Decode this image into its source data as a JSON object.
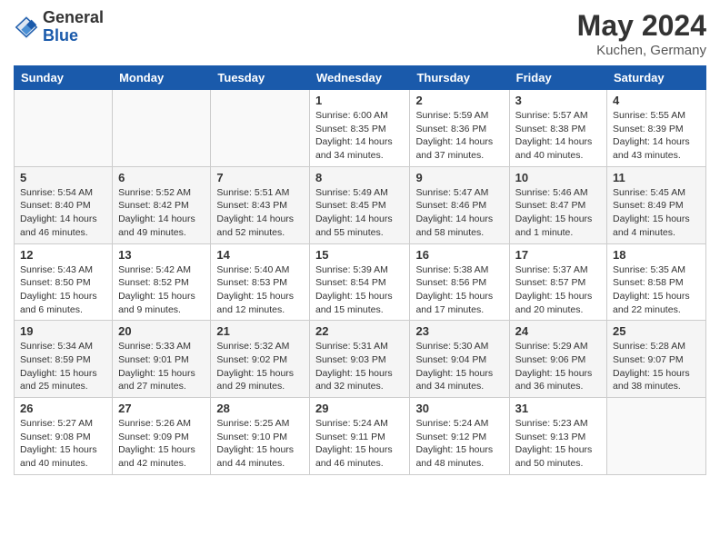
{
  "header": {
    "logo_general": "General",
    "logo_blue": "Blue",
    "month_year": "May 2024",
    "location": "Kuchen, Germany"
  },
  "weekdays": [
    "Sunday",
    "Monday",
    "Tuesday",
    "Wednesday",
    "Thursday",
    "Friday",
    "Saturday"
  ],
  "weeks": [
    [
      {
        "day": "",
        "info": ""
      },
      {
        "day": "",
        "info": ""
      },
      {
        "day": "",
        "info": ""
      },
      {
        "day": "1",
        "info": "Sunrise: 6:00 AM\nSunset: 8:35 PM\nDaylight: 14 hours\nand 34 minutes."
      },
      {
        "day": "2",
        "info": "Sunrise: 5:59 AM\nSunset: 8:36 PM\nDaylight: 14 hours\nand 37 minutes."
      },
      {
        "day": "3",
        "info": "Sunrise: 5:57 AM\nSunset: 8:38 PM\nDaylight: 14 hours\nand 40 minutes."
      },
      {
        "day": "4",
        "info": "Sunrise: 5:55 AM\nSunset: 8:39 PM\nDaylight: 14 hours\nand 43 minutes."
      }
    ],
    [
      {
        "day": "5",
        "info": "Sunrise: 5:54 AM\nSunset: 8:40 PM\nDaylight: 14 hours\nand 46 minutes."
      },
      {
        "day": "6",
        "info": "Sunrise: 5:52 AM\nSunset: 8:42 PM\nDaylight: 14 hours\nand 49 minutes."
      },
      {
        "day": "7",
        "info": "Sunrise: 5:51 AM\nSunset: 8:43 PM\nDaylight: 14 hours\nand 52 minutes."
      },
      {
        "day": "8",
        "info": "Sunrise: 5:49 AM\nSunset: 8:45 PM\nDaylight: 14 hours\nand 55 minutes."
      },
      {
        "day": "9",
        "info": "Sunrise: 5:47 AM\nSunset: 8:46 PM\nDaylight: 14 hours\nand 58 minutes."
      },
      {
        "day": "10",
        "info": "Sunrise: 5:46 AM\nSunset: 8:47 PM\nDaylight: 15 hours\nand 1 minute."
      },
      {
        "day": "11",
        "info": "Sunrise: 5:45 AM\nSunset: 8:49 PM\nDaylight: 15 hours\nand 4 minutes."
      }
    ],
    [
      {
        "day": "12",
        "info": "Sunrise: 5:43 AM\nSunset: 8:50 PM\nDaylight: 15 hours\nand 6 minutes."
      },
      {
        "day": "13",
        "info": "Sunrise: 5:42 AM\nSunset: 8:52 PM\nDaylight: 15 hours\nand 9 minutes."
      },
      {
        "day": "14",
        "info": "Sunrise: 5:40 AM\nSunset: 8:53 PM\nDaylight: 15 hours\nand 12 minutes."
      },
      {
        "day": "15",
        "info": "Sunrise: 5:39 AM\nSunset: 8:54 PM\nDaylight: 15 hours\nand 15 minutes."
      },
      {
        "day": "16",
        "info": "Sunrise: 5:38 AM\nSunset: 8:56 PM\nDaylight: 15 hours\nand 17 minutes."
      },
      {
        "day": "17",
        "info": "Sunrise: 5:37 AM\nSunset: 8:57 PM\nDaylight: 15 hours\nand 20 minutes."
      },
      {
        "day": "18",
        "info": "Sunrise: 5:35 AM\nSunset: 8:58 PM\nDaylight: 15 hours\nand 22 minutes."
      }
    ],
    [
      {
        "day": "19",
        "info": "Sunrise: 5:34 AM\nSunset: 8:59 PM\nDaylight: 15 hours\nand 25 minutes."
      },
      {
        "day": "20",
        "info": "Sunrise: 5:33 AM\nSunset: 9:01 PM\nDaylight: 15 hours\nand 27 minutes."
      },
      {
        "day": "21",
        "info": "Sunrise: 5:32 AM\nSunset: 9:02 PM\nDaylight: 15 hours\nand 29 minutes."
      },
      {
        "day": "22",
        "info": "Sunrise: 5:31 AM\nSunset: 9:03 PM\nDaylight: 15 hours\nand 32 minutes."
      },
      {
        "day": "23",
        "info": "Sunrise: 5:30 AM\nSunset: 9:04 PM\nDaylight: 15 hours\nand 34 minutes."
      },
      {
        "day": "24",
        "info": "Sunrise: 5:29 AM\nSunset: 9:06 PM\nDaylight: 15 hours\nand 36 minutes."
      },
      {
        "day": "25",
        "info": "Sunrise: 5:28 AM\nSunset: 9:07 PM\nDaylight: 15 hours\nand 38 minutes."
      }
    ],
    [
      {
        "day": "26",
        "info": "Sunrise: 5:27 AM\nSunset: 9:08 PM\nDaylight: 15 hours\nand 40 minutes."
      },
      {
        "day": "27",
        "info": "Sunrise: 5:26 AM\nSunset: 9:09 PM\nDaylight: 15 hours\nand 42 minutes."
      },
      {
        "day": "28",
        "info": "Sunrise: 5:25 AM\nSunset: 9:10 PM\nDaylight: 15 hours\nand 44 minutes."
      },
      {
        "day": "29",
        "info": "Sunrise: 5:24 AM\nSunset: 9:11 PM\nDaylight: 15 hours\nand 46 minutes."
      },
      {
        "day": "30",
        "info": "Sunrise: 5:24 AM\nSunset: 9:12 PM\nDaylight: 15 hours\nand 48 minutes."
      },
      {
        "day": "31",
        "info": "Sunrise: 5:23 AM\nSunset: 9:13 PM\nDaylight: 15 hours\nand 50 minutes."
      },
      {
        "day": "",
        "info": ""
      }
    ]
  ]
}
